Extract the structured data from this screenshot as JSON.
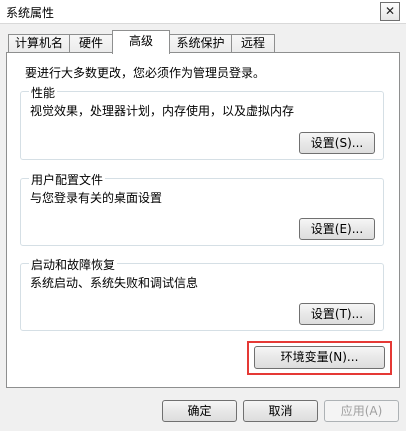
{
  "window": {
    "title": "系统属性",
    "close_glyph": "✕"
  },
  "tabs": [
    {
      "label": "计算机名"
    },
    {
      "label": "硬件"
    },
    {
      "label": "高级"
    },
    {
      "label": "系统保护"
    },
    {
      "label": "远程"
    }
  ],
  "advanced": {
    "admin_note": "要进行大多数更改，您必须作为管理员登录。",
    "performance": {
      "title": "性能",
      "description": "视觉效果，处理器计划，内存使用，以及虚拟内存",
      "settings_label": "设置(S)..."
    },
    "user_profiles": {
      "title": "用户配置文件",
      "description": "与您登录有关的桌面设置",
      "settings_label": "设置(E)..."
    },
    "startup_recovery": {
      "title": "启动和故障恢复",
      "description": "系统启动、系统失败和调试信息",
      "settings_label": "设置(T)..."
    },
    "env_vars_label": "环境变量(N)..."
  },
  "footer": {
    "ok_label": "确定",
    "cancel_label": "取消",
    "apply_label": "应用(A)"
  },
  "colors": {
    "highlight": "#e53935",
    "dialog_bg": "#f0f0f0",
    "panel_bg": "#ffffff"
  }
}
